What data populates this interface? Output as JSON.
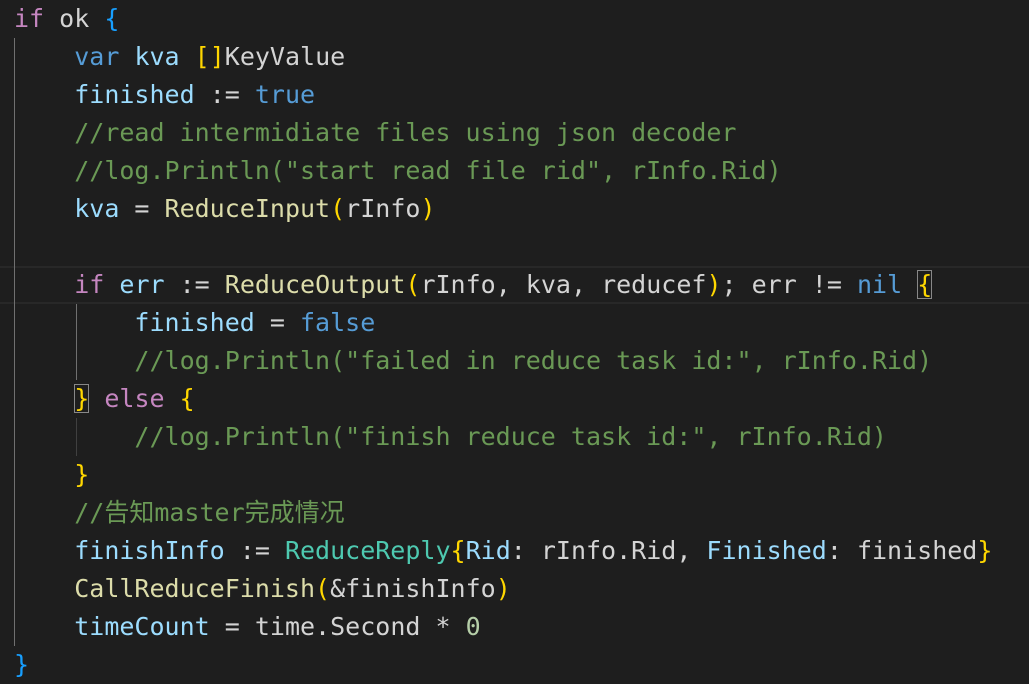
{
  "editor": {
    "language": "go",
    "theme_colors": {
      "background": "#1e1e1e",
      "keyword": "#569cd6",
      "control": "#c586c0",
      "variable": "#9cdcfe",
      "function": "#dcdcaa",
      "type": "#4ec9b0",
      "comment": "#6a9955",
      "number": "#b5cea8",
      "bracket_gold": "#ffd700",
      "bracket_orchid": "#da70d6",
      "bracket_blue": "#179fff"
    },
    "lines": [
      {
        "tokens": [
          {
            "t": "if",
            "c": "ctrl"
          },
          {
            "t": " ok ",
            "c": "plain"
          },
          {
            "t": "{",
            "c": "b3"
          }
        ]
      },
      {
        "tokens": [
          {
            "t": "    ",
            "c": "plain"
          },
          {
            "t": "var",
            "c": "kw"
          },
          {
            "t": " ",
            "c": "plain"
          },
          {
            "t": "kva",
            "c": "var"
          },
          {
            "t": " ",
            "c": "plain"
          },
          {
            "t": "[]",
            "c": "b1"
          },
          {
            "t": "KeyValue",
            "c": "plain"
          }
        ]
      },
      {
        "tokens": [
          {
            "t": "    ",
            "c": "plain"
          },
          {
            "t": "finished",
            "c": "var"
          },
          {
            "t": " := ",
            "c": "op"
          },
          {
            "t": "true",
            "c": "kw"
          }
        ]
      },
      {
        "tokens": [
          {
            "t": "    ",
            "c": "plain"
          },
          {
            "t": "//read intermidiate files using json decoder",
            "c": "cmt"
          }
        ]
      },
      {
        "tokens": [
          {
            "t": "    ",
            "c": "plain"
          },
          {
            "t": "//log.Println(\"start read file rid\", rInfo.Rid)",
            "c": "cmt"
          }
        ]
      },
      {
        "tokens": [
          {
            "t": "    ",
            "c": "plain"
          },
          {
            "t": "kva",
            "c": "var"
          },
          {
            "t": " = ",
            "c": "op"
          },
          {
            "t": "ReduceInput",
            "c": "fn"
          },
          {
            "t": "(",
            "c": "b1"
          },
          {
            "t": "rInfo",
            "c": "plain"
          },
          {
            "t": ")",
            "c": "b1"
          }
        ]
      },
      {
        "tokens": []
      },
      {
        "tokens": [
          {
            "t": "    ",
            "c": "plain"
          },
          {
            "t": "if",
            "c": "ctrl"
          },
          {
            "t": " ",
            "c": "plain"
          },
          {
            "t": "err",
            "c": "var"
          },
          {
            "t": " := ",
            "c": "op"
          },
          {
            "t": "ReduceOutput",
            "c": "fn"
          },
          {
            "t": "(",
            "c": "b1"
          },
          {
            "t": "rInfo, kva, reducef",
            "c": "plain"
          },
          {
            "t": ")",
            "c": "b1"
          },
          {
            "t": "; err != ",
            "c": "plain"
          },
          {
            "t": "nil",
            "c": "kw"
          },
          {
            "t": " ",
            "c": "plain"
          },
          {
            "t": "{",
            "c": "b1",
            "match": true
          }
        ]
      },
      {
        "tokens": [
          {
            "t": "        ",
            "c": "plain"
          },
          {
            "t": "finished",
            "c": "var"
          },
          {
            "t": " = ",
            "c": "op"
          },
          {
            "t": "false",
            "c": "kw"
          }
        ]
      },
      {
        "tokens": [
          {
            "t": "        ",
            "c": "plain"
          },
          {
            "t": "//log.Println(\"failed in reduce task id:\", rInfo.Rid)",
            "c": "cmt"
          }
        ]
      },
      {
        "tokens": [
          {
            "t": "    ",
            "c": "plain"
          },
          {
            "t": "}",
            "c": "b1",
            "match": true
          },
          {
            "t": " ",
            "c": "plain"
          },
          {
            "t": "else",
            "c": "ctrl"
          },
          {
            "t": " ",
            "c": "plain"
          },
          {
            "t": "{",
            "c": "b1"
          }
        ]
      },
      {
        "tokens": [
          {
            "t": "        ",
            "c": "plain"
          },
          {
            "t": "//log.Println(\"finish reduce task id:\", rInfo.Rid)",
            "c": "cmt"
          }
        ]
      },
      {
        "tokens": [
          {
            "t": "    ",
            "c": "plain"
          },
          {
            "t": "}",
            "c": "b1"
          }
        ]
      },
      {
        "tokens": [
          {
            "t": "    ",
            "c": "plain"
          },
          {
            "t": "//告知master完成情况",
            "c": "cmt"
          }
        ]
      },
      {
        "tokens": [
          {
            "t": "    ",
            "c": "plain"
          },
          {
            "t": "finishInfo",
            "c": "var"
          },
          {
            "t": " := ",
            "c": "op"
          },
          {
            "t": "ReduceReply",
            "c": "type"
          },
          {
            "t": "{",
            "c": "b1"
          },
          {
            "t": "Rid",
            "c": "var"
          },
          {
            "t": ": rInfo.Rid, ",
            "c": "plain"
          },
          {
            "t": "Finished",
            "c": "var"
          },
          {
            "t": ": finished",
            "c": "plain"
          },
          {
            "t": "}",
            "c": "b1"
          }
        ]
      },
      {
        "tokens": [
          {
            "t": "    ",
            "c": "plain"
          },
          {
            "t": "CallReduceFinish",
            "c": "fn"
          },
          {
            "t": "(",
            "c": "b1"
          },
          {
            "t": "&finishInfo",
            "c": "plain"
          },
          {
            "t": ")",
            "c": "b1"
          }
        ]
      },
      {
        "tokens": [
          {
            "t": "    ",
            "c": "plain"
          },
          {
            "t": "timeCount",
            "c": "var"
          },
          {
            "t": " = time.",
            "c": "plain"
          },
          {
            "t": "Second",
            "c": "plain"
          },
          {
            "t": " * ",
            "c": "op"
          },
          {
            "t": "0",
            "c": "num"
          }
        ]
      },
      {
        "tokens": [
          {
            "t": "}",
            "c": "b3"
          }
        ]
      }
    ]
  }
}
